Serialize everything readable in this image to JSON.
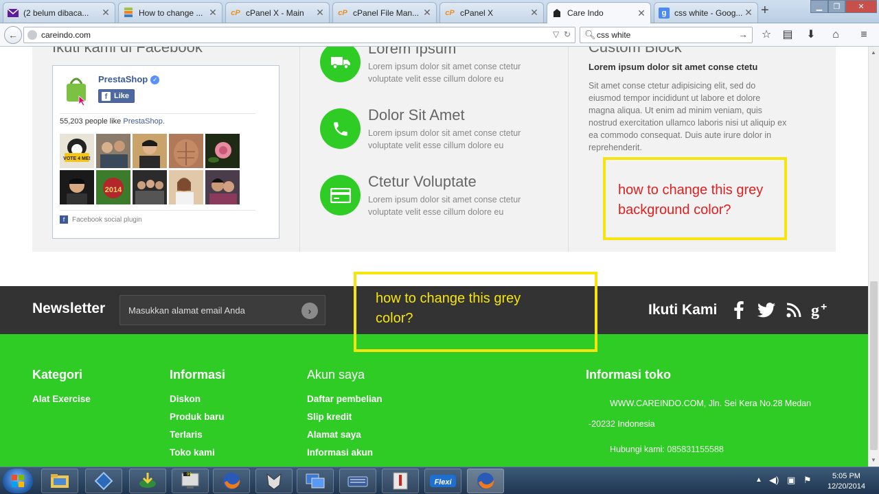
{
  "browser": {
    "tabs": [
      {
        "label": "(2 belum dibaca...",
        "icon": "yahoo-mail-icon",
        "active": false
      },
      {
        "label": "How to change ...",
        "icon": "stackexchange-icon",
        "active": false
      },
      {
        "label": "cPanel X - Main",
        "icon": "cpanel-icon",
        "active": false
      },
      {
        "label": "cPanel File Man...",
        "icon": "cpanel-icon",
        "active": false
      },
      {
        "label": "cPanel X",
        "icon": "cpanel-icon",
        "active": false
      },
      {
        "label": "Care Indo",
        "icon": "careindo-icon",
        "active": true
      },
      {
        "label": "css white - Goog...",
        "icon": "google-icon",
        "active": false
      }
    ],
    "url": "careindo.com",
    "search": "css white"
  },
  "page": {
    "facebook": {
      "heading": "Ikuti kami di Facebook",
      "page_name": "PrestaShop",
      "like_label": "Like",
      "count_text": "55,203 people like ",
      "count_link": "PrestaShop.",
      "plugin_label": "Facebook social plugin"
    },
    "features": [
      {
        "title": "Lorem Ipsum",
        "text": "Lorem ipsum dolor sit amet conse ctetur voluptate velit esse cillum dolore eu",
        "icon": "truck-icon"
      },
      {
        "title": "Dolor Sit Amet",
        "text": "Lorem ipsum dolor sit amet conse ctetur voluptate velit esse cillum dolore eu",
        "icon": "phone-icon"
      },
      {
        "title": "Ctetur Voluptate",
        "text": "Lorem ipsum dolor sit amet conse ctetur voluptate velit esse cillum dolore eu",
        "icon": "credit-card-icon"
      }
    ],
    "custom_block": {
      "heading": "Custom Block",
      "subheading": "Lorem ipsum dolor sit amet conse ctetu",
      "text": "Sit amet conse ctetur adipisicing elit, sed do eiusmod tempor incididunt ut labore et dolore magna aliqua. Ut enim ad minim veniam, quis nostrud exercitation ullamco laboris nisi ut aliquip ex ea commodo consequat. Duis aute irure dolor in reprehenderit."
    },
    "annotations": {
      "grey_background": "how to change this grey background color?",
      "grey_color": "how to change this grey color?"
    },
    "newsletter": {
      "title": "Newsletter",
      "placeholder": "Masukkan alamat email Anda",
      "follow_label": "Ikuti Kami"
    },
    "footer": {
      "kategori": {
        "heading": "Kategori",
        "links": [
          "Alat Exercise"
        ]
      },
      "informasi": {
        "heading": "Informasi",
        "links": [
          "Diskon",
          "Produk baru",
          "Terlaris",
          "Toko kami"
        ]
      },
      "akun": {
        "heading": "Akun saya",
        "links": [
          "Daftar pembelian",
          "Slip kredit",
          "Alamat saya",
          "Informasi akun"
        ]
      },
      "toko": {
        "heading": "Informasi toko",
        "address_line1": "WWW.CAREINDO.COM, Jln. Sei Kera No.28 Medan",
        "address_line2": "-20232 Indonesia",
        "phone_label": "Hubungi kami: ",
        "phone": "085831155588"
      }
    }
  },
  "taskbar": {
    "time": "5:05 PM",
    "date": "12/20/2014"
  },
  "colors": {
    "green": "#2fcc25",
    "grey_bar": "#333333",
    "grey_box": "#f2f2f2",
    "annotation": "#f5e50c"
  }
}
